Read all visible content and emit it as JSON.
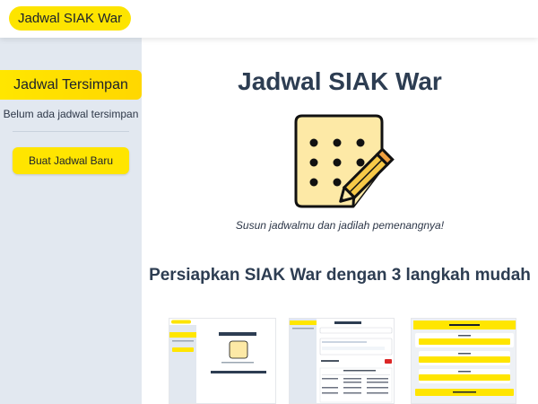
{
  "header": {
    "brand": "Jadwal SIAK War"
  },
  "sidebar": {
    "title": "Jadwal Tersimpan",
    "empty_text": "Belum ada jadwal tersimpan",
    "new_button": "Buat Jadwal Baru"
  },
  "main": {
    "title": "Jadwal SIAK War",
    "hero_icon": "schedule-pencil-icon",
    "tagline": "Susun jadwalmu dan jadilah pemenangnya!",
    "steps_heading": "Persiapkan SIAK War dengan 3 langkah mudah",
    "step_images": [
      "step-1-screenshot",
      "step-2-screenshot",
      "step-3-screenshot"
    ]
  },
  "colors": {
    "accent": "#FFE500",
    "heading": "#2D3D52",
    "sidebar_bg": "#E2E8F0"
  }
}
